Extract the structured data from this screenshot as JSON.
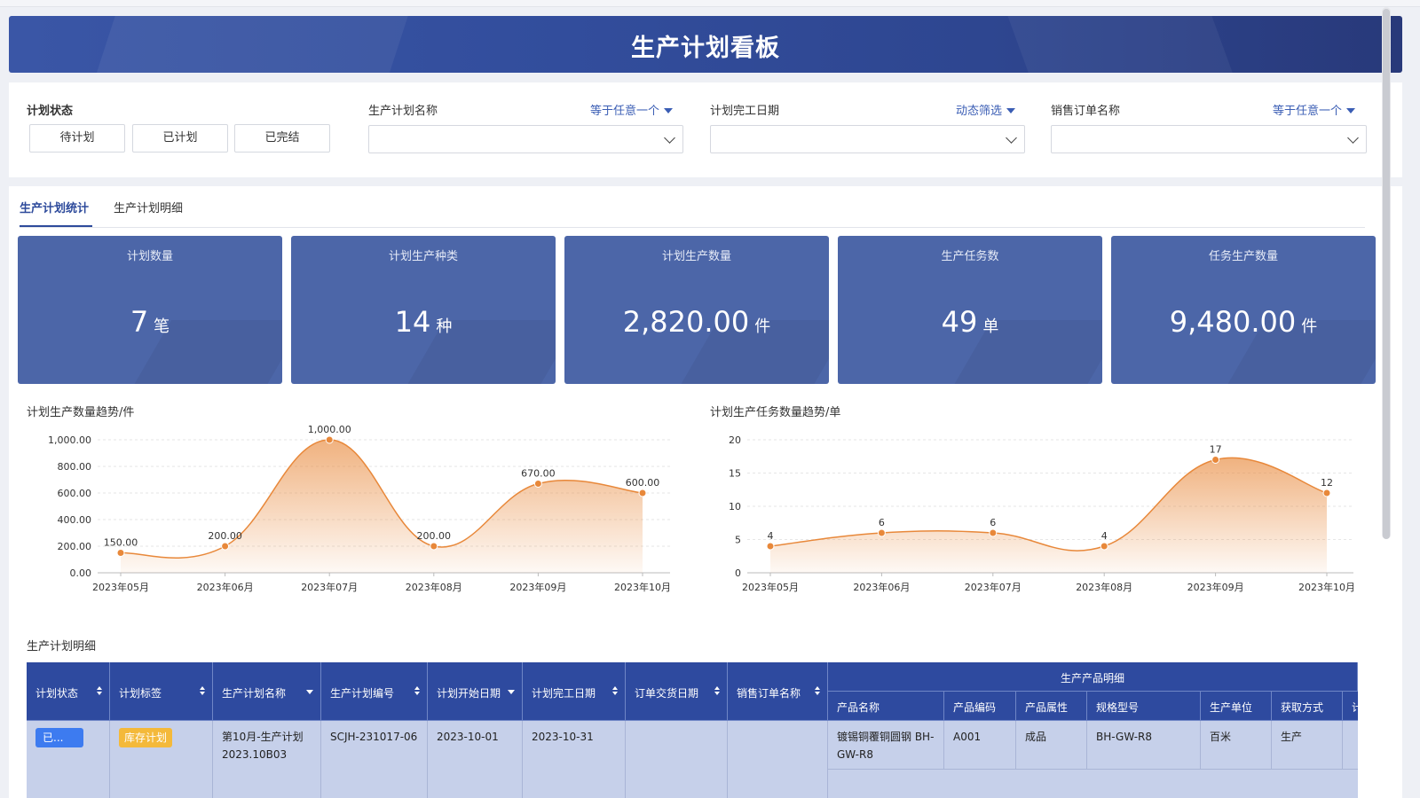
{
  "title": "生产计划看板",
  "filters": {
    "status_label": "计划状态",
    "status_buttons": [
      "待计划",
      "已计划",
      "已完结"
    ],
    "plan_name": {
      "label": "生产计划名称",
      "mode": "等于任意一个"
    },
    "finish_date": {
      "label": "计划完工日期",
      "mode": "动态筛选"
    },
    "sales_order": {
      "label": "销售订单名称",
      "mode": "等于任意一个"
    }
  },
  "tabs": [
    "生产计划统计",
    "生产计划明细"
  ],
  "kpis": [
    {
      "title": "计划数量",
      "value": "7",
      "unit": "笔"
    },
    {
      "title": "计划生产种类",
      "value": "14",
      "unit": "种"
    },
    {
      "title": "计划生产数量",
      "value": "2,820.00",
      "unit": "件"
    },
    {
      "title": "生产任务数",
      "value": "49",
      "unit": "单"
    },
    {
      "title": "任务生产数量",
      "value": "9,480.00",
      "unit": "件"
    }
  ],
  "colors": {
    "primary": "#2e4a9f",
    "kpi_bg": "#4c66a8",
    "line": "#e8883a",
    "tag": "#f4b93a",
    "status": "#3d7bf0"
  },
  "chart_data": [
    {
      "type": "area",
      "title": "计划生产数量趋势/件",
      "categories": [
        "2023年05月",
        "2023年06月",
        "2023年07月",
        "2023年08月",
        "2023年09月",
        "2023年10月"
      ],
      "values": [
        150,
        200,
        1000,
        200,
        670,
        600
      ],
      "data_labels": [
        "150.00",
        "200.00",
        "1,000.00",
        "200.00",
        "670.00",
        "600.00"
      ],
      "ylim": [
        0,
        1000
      ],
      "yticks": [
        "0.00",
        "200.00",
        "400.00",
        "600.00",
        "800.00",
        "1,000.00"
      ],
      "grid": true
    },
    {
      "type": "area",
      "title": "计划生产任务数量趋势/单",
      "categories": [
        "2023年05月",
        "2023年06月",
        "2023年07月",
        "2023年08月",
        "2023年09月",
        "2023年10月"
      ],
      "values": [
        4,
        6,
        6,
        4,
        17,
        12
      ],
      "data_labels": [
        "4",
        "6",
        "6",
        "4",
        "17",
        "12"
      ],
      "ylim": [
        0,
        20
      ],
      "yticks": [
        "0",
        "5",
        "10",
        "15",
        "20"
      ],
      "grid": true
    }
  ],
  "detail": {
    "title": "生产计划明细",
    "columns": [
      "计划状态",
      "计划标签",
      "生产计划名称",
      "生产计划编号",
      "计划开始日期",
      "计划完工日期",
      "订单交货日期",
      "销售订单名称"
    ],
    "group_title": "生产产品明细",
    "sub_columns": [
      "产品名称",
      "产品编码",
      "产品属性",
      "规格型号",
      "生产单位",
      "获取方式",
      "计"
    ],
    "row": {
      "status": "已...",
      "tag": "库存计划",
      "plan_name": "第10月-生产计划 2023.10B03",
      "plan_code": "SCJH-231017-06",
      "start": "2023-10-01",
      "finish": "2023-10-31",
      "delivery": "",
      "sales_order": "",
      "product_name": "镀锡铜覆铜圆钢 BH-GW-R8",
      "product_code": "A001",
      "attribute": "成品",
      "spec": "BH-GW-R8",
      "unit": "百米",
      "acquire": "生产"
    }
  }
}
